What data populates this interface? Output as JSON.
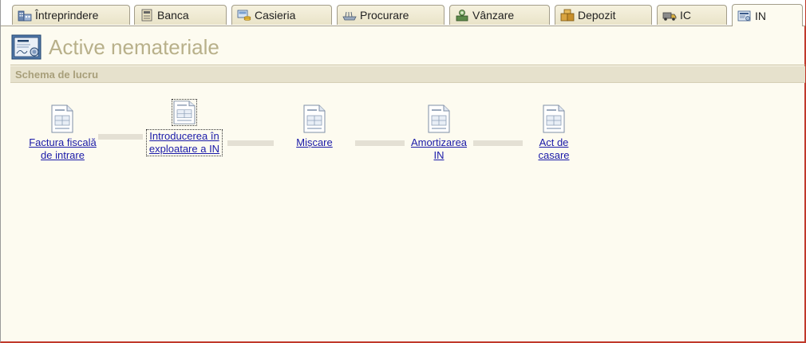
{
  "tabs": [
    {
      "label": "Întreprindere",
      "icon": "enterprise-icon",
      "active": false
    },
    {
      "label": "Banca",
      "icon": "bank-icon",
      "active": false
    },
    {
      "label": "Casieria",
      "icon": "cashier-icon",
      "active": false
    },
    {
      "label": "Procurare",
      "icon": "procurement-icon",
      "active": false
    },
    {
      "label": "Vânzare",
      "icon": "sales-icon",
      "active": false
    },
    {
      "label": "Depozit",
      "icon": "warehouse-icon",
      "active": false
    },
    {
      "label": "IC",
      "icon": "truck-icon",
      "active": false
    },
    {
      "label": "IN",
      "icon": "intangible-assets-icon",
      "active": true
    }
  ],
  "header": {
    "title": "Active nemateriale",
    "icon": "intangible-assets-icon"
  },
  "section": {
    "title": "Schema de lucru"
  },
  "workflow": {
    "nodes": [
      {
        "line1": "Factura fiscală",
        "line2": "de intrare",
        "icon": "document-icon"
      },
      {
        "line1": "Introducerea în",
        "line2": "exploatare a IN",
        "icon": "document-icon"
      },
      {
        "line1": "Mișcare",
        "line2": "",
        "icon": "document-icon"
      },
      {
        "line1": "Amortizarea",
        "line2": "IN",
        "icon": "document-icon"
      },
      {
        "line1": "Act de",
        "line2": "casare",
        "icon": "document-icon"
      }
    ]
  },
  "colors": {
    "background": "#fdfbf0",
    "title": "#b8b08a",
    "section_bar": "#e6e1cc",
    "link": "#1a1aa8",
    "frame_accent": "#c0392b"
  }
}
